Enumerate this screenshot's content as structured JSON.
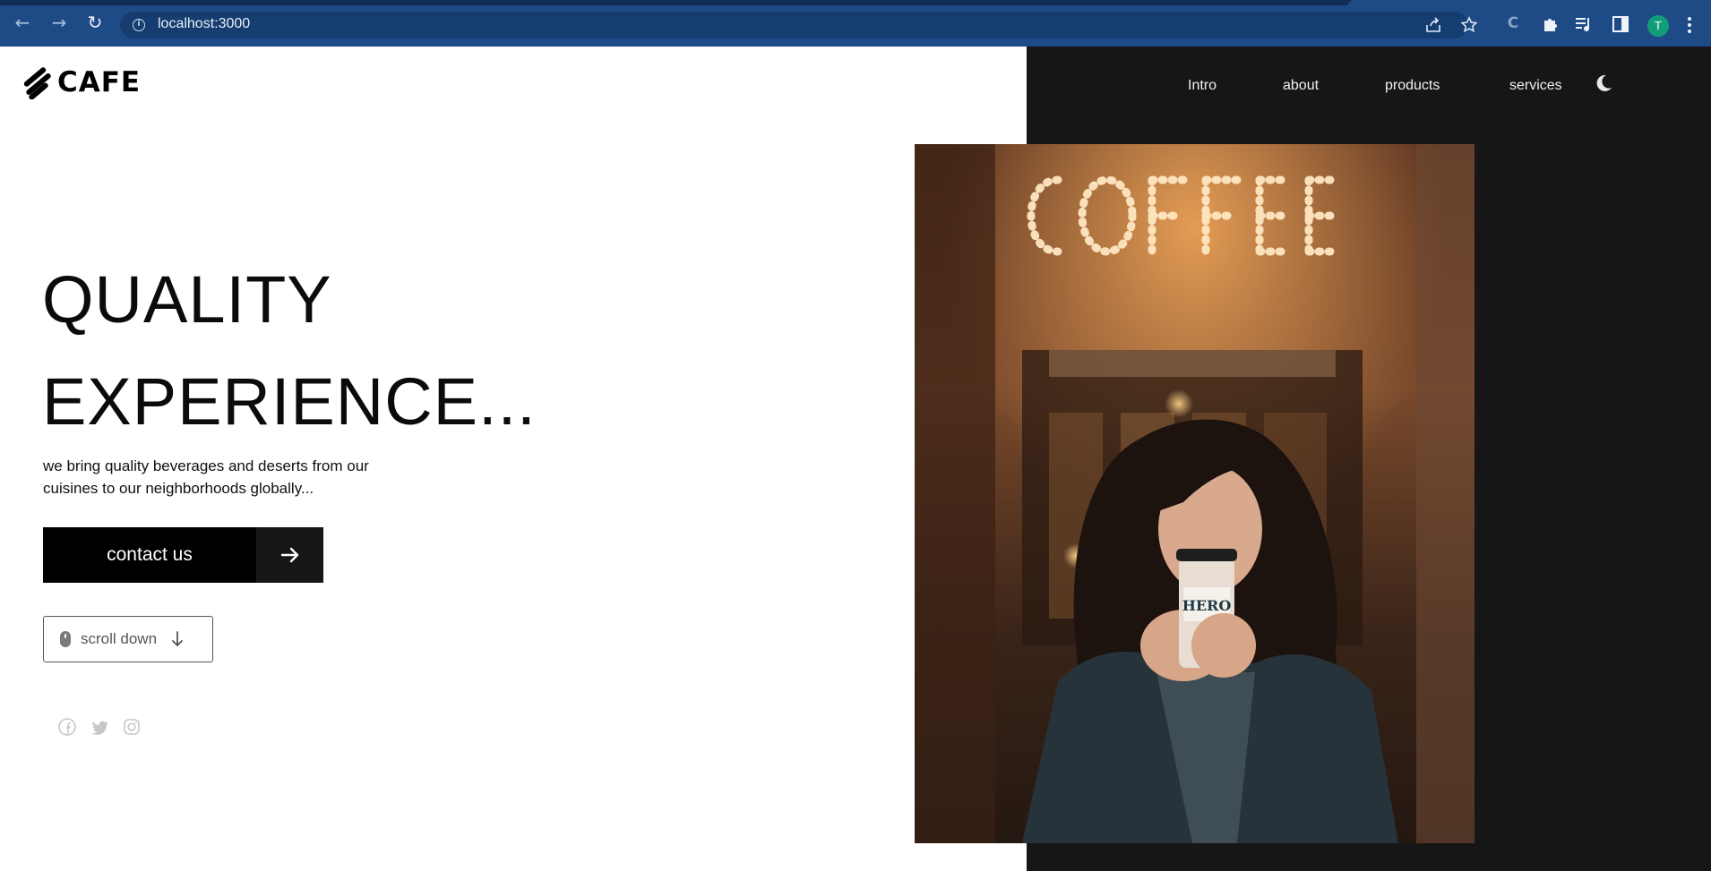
{
  "browser": {
    "url": "localhost:3000",
    "profile_initial": "T",
    "icons": [
      "back-icon",
      "forward-icon",
      "reload-icon",
      "site-info-icon",
      "share-icon",
      "bookmark-star-icon",
      "extension-c-icon",
      "extensions-puzzle-icon",
      "media-controls-icon",
      "side-panel-icon",
      "menu-kebab-icon"
    ]
  },
  "header": {
    "logo_text": "CAFE",
    "nav": [
      "Intro",
      "about",
      "products",
      "services"
    ],
    "theme_icon": "moon-icon"
  },
  "hero": {
    "title_line1": "QUALITY",
    "title_line2": "EXPERIENCE...",
    "description": "we bring quality beverages and deserts from our cuisines to our neighborhoods globally...",
    "cta_label": "contact us",
    "scroll_label": "scroll down",
    "image_alt": "Woman holding a HERO coffee cup in front of a lit COFFEE sign"
  },
  "social": [
    "facebook-icon",
    "twitter-icon",
    "instagram-icon"
  ],
  "colors": {
    "chrome": "#1e4b86",
    "dark_panel": "#161616",
    "button": "#000000",
    "social_icons": "#c8c8c8"
  }
}
